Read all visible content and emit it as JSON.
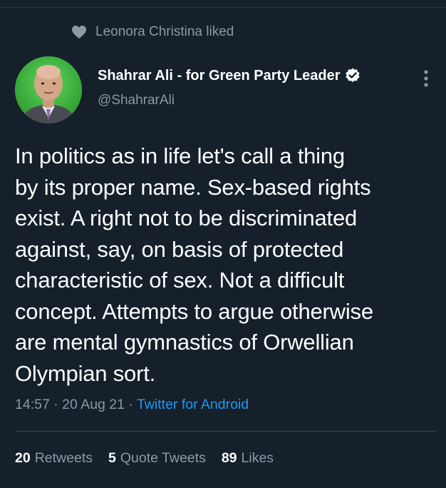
{
  "social_context": {
    "icon": "heart-icon",
    "text": "Leonora Christina liked"
  },
  "author": {
    "display_name": "Shahrar Ali - for Green Party Leader",
    "handle": "@ShahrarAli",
    "verified_icon": "verified-badge-icon"
  },
  "tweet": {
    "text": "In politics as in life let's call a thing\nby its proper name. Sex-based rights\nexist. A right not to be discriminated\nagainst, say, on basis of protected\ncharacteristic of sex. Not a difficult\nconcept. Attempts to argue otherwise\nare mental gymnastics of Orwellian\nOlympian sort.",
    "time": "14:57",
    "separator": " · ",
    "date": "20 Aug 21",
    "source": "Twitter for Android"
  },
  "stats": {
    "retweets_count": "20",
    "retweets_label": "Retweets",
    "quotes_count": "5",
    "quotes_label": "Quote Tweets",
    "likes_count": "89",
    "likes_label": "Likes"
  },
  "colors": {
    "background": "#15202b",
    "secondary_text": "#8b98a5",
    "link": "#1d9bf0",
    "avatar_bg": "#3bb03b"
  }
}
